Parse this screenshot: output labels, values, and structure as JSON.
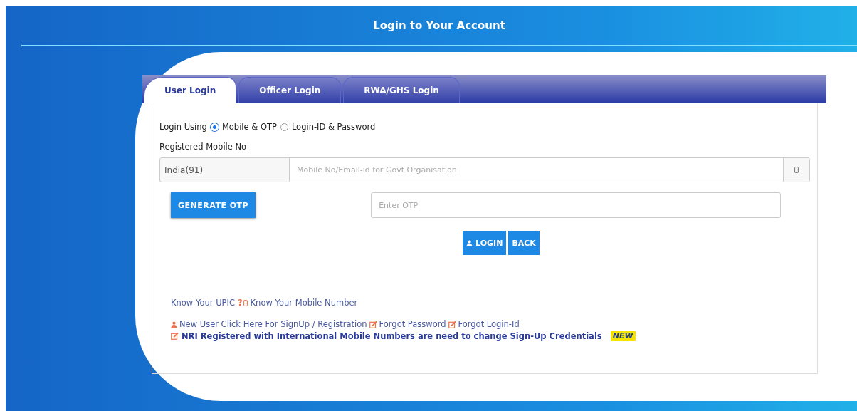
{
  "header": {
    "title": "Login to Your Account"
  },
  "tabs": [
    {
      "label": "User Login",
      "selected": true
    },
    {
      "label": "Officer Login",
      "selected": false
    },
    {
      "label": "RWA/GHS Login",
      "selected": false
    }
  ],
  "login_using": {
    "label": "Login Using",
    "options": [
      {
        "label": "Mobile & OTP",
        "selected": true
      },
      {
        "label": "Login-ID & Password",
        "selected": false
      }
    ]
  },
  "mobile": {
    "label": "Registered Mobile No",
    "country": "India(91)",
    "placeholder": "Mobile No/Email-id for Govt Organisation"
  },
  "otp": {
    "button": "GENERATE OTP",
    "placeholder": "Enter OTP"
  },
  "buttons": [
    {
      "kind": "login",
      "label": "LOGIN"
    },
    {
      "kind": "back",
      "label": "BACK"
    }
  ],
  "help_links": {
    "upic": "Know Your UPIC",
    "question": "?",
    "mobile": "Know Your Mobile Number"
  },
  "account_links": [
    {
      "kind": "user",
      "label": "New User Click Here For SignUp / Registration"
    },
    {
      "kind": "edit",
      "label": "Forgot Password"
    },
    {
      "kind": "edit",
      "label": "Forgot Login-Id"
    }
  ],
  "nri_notice": {
    "label": "NRI Registered with International Mobile Numbers are need to change Sign-Up Credentials",
    "badge": "NEW"
  }
}
